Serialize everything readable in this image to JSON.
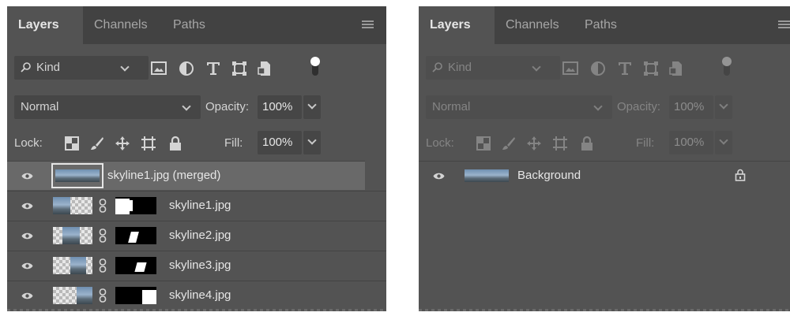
{
  "left_panel": {
    "tabs": [
      {
        "label": "Layers",
        "active": true
      },
      {
        "label": "Channels",
        "active": false
      },
      {
        "label": "Paths",
        "active": false
      }
    ],
    "filter": {
      "kind_label": "Kind",
      "icons": [
        "pixel-layer-filter-icon",
        "adjustment-layer-filter-icon",
        "type-layer-filter-icon",
        "shape-layer-filter-icon",
        "smart-object-filter-icon",
        "filter-toggle-icon"
      ]
    },
    "blend_mode": "Normal",
    "opacity_label": "Opacity:",
    "opacity_value": "100%",
    "lock_label": "Lock:",
    "lock_icons": [
      "lock-transparent-pixels-icon",
      "lock-image-pixels-icon",
      "lock-position-icon",
      "lock-artboard-icon",
      "lock-all-icon"
    ],
    "fill_label": "Fill:",
    "fill_value": "100%",
    "layers": [
      {
        "name": "skyline1.jpg (merged)",
        "selected": true,
        "type": "merged"
      },
      {
        "name": "skyline1.jpg",
        "selected": false,
        "type": "masked"
      },
      {
        "name": "skyline2.jpg",
        "selected": false,
        "type": "masked"
      },
      {
        "name": "skyline3.jpg",
        "selected": false,
        "type": "masked"
      },
      {
        "name": "skyline4.jpg",
        "selected": false,
        "type": "masked"
      }
    ]
  },
  "right_panel": {
    "tabs": [
      {
        "label": "Layers",
        "active": true
      },
      {
        "label": "Channels",
        "active": false
      },
      {
        "label": "Paths",
        "active": false
      }
    ],
    "filter": {
      "kind_label": "Kind",
      "disabled": true
    },
    "blend_mode": "Normal",
    "opacity_label": "Opacity:",
    "opacity_value": "100%",
    "lock_label": "Lock:",
    "fill_label": "Fill:",
    "fill_value": "100%",
    "layers": [
      {
        "name": "Background",
        "selected": false,
        "locked": true
      }
    ]
  },
  "colors": {
    "panel_bg": "#535353",
    "tabbar_bg": "#424242",
    "selected_row": "#696969",
    "text": "#e6e6e6"
  }
}
